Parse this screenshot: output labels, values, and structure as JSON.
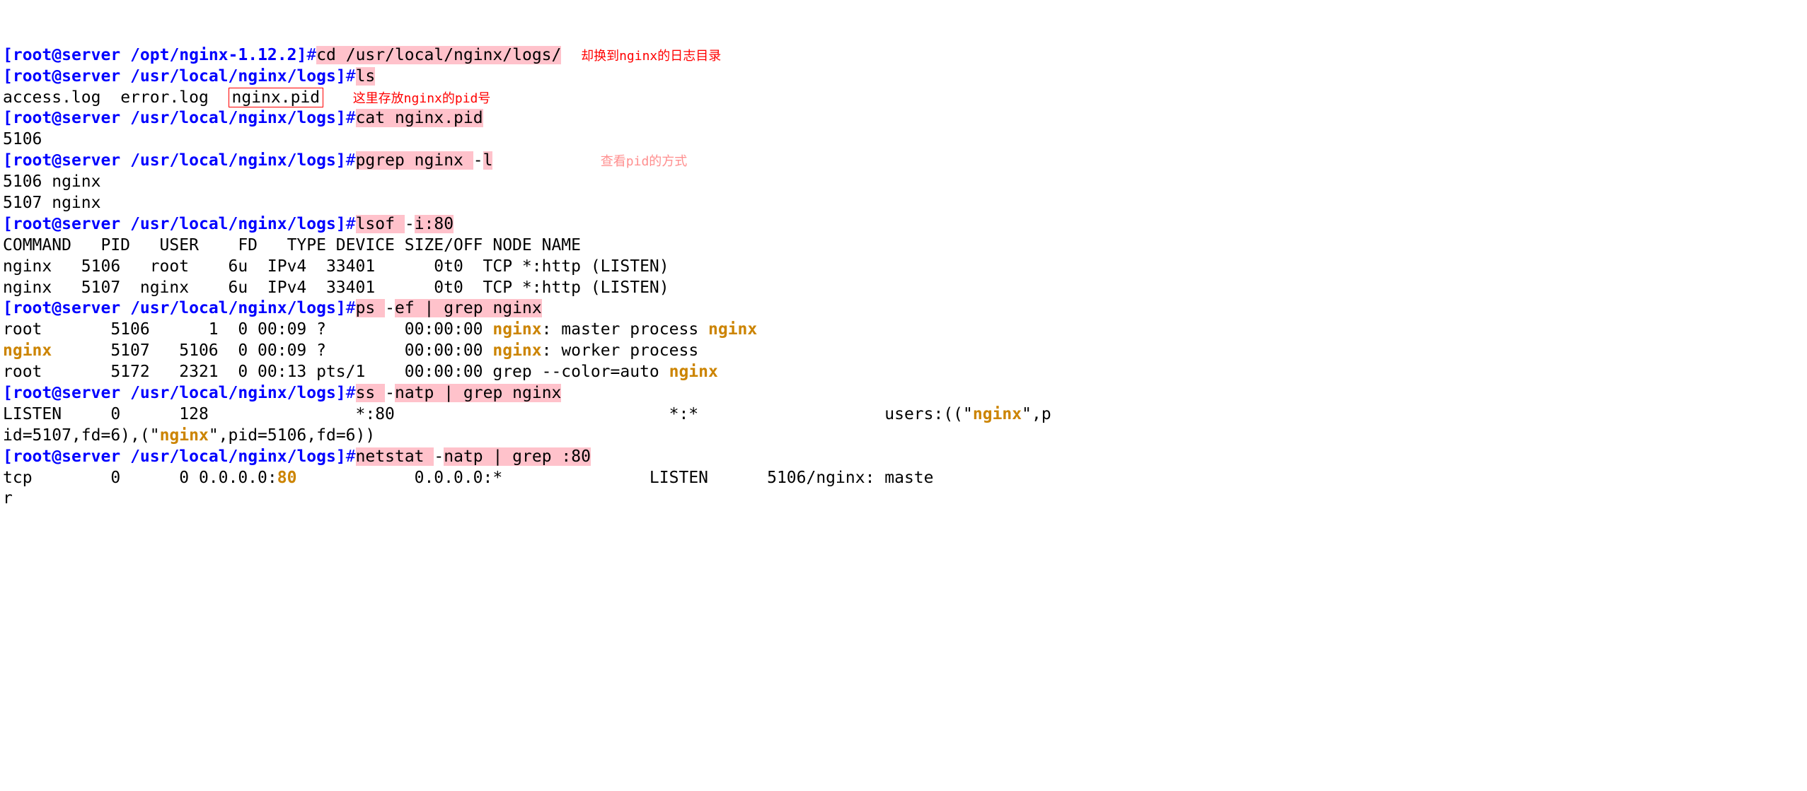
{
  "prompt": {
    "user": "root",
    "host": "server",
    "path1": "/opt/nginx-1.12.2",
    "path2": "/usr/local/nginx/logs"
  },
  "commands": {
    "cd": "cd /usr/local/nginx/logs/",
    "ls": "ls",
    "cat": "cat nginx.pid",
    "pgrep_pre": "pgrep nginx ",
    "pgrep_flag": "-",
    "pgrep_flag2": "l",
    "lsof_pre": "lsof ",
    "lsof_flag": "-",
    "lsof_rest": "i:80",
    "ps_pre": "ps ",
    "ps_dash": "-",
    "ps_rest": "ef | grep nginx",
    "ss_pre": "ss ",
    "ss_dash": "-",
    "ss_rest": "natp | grep nginx",
    "netstat_pre": "netstat ",
    "netstat_dash": "-",
    "netstat_rest": "natp | grep :80"
  },
  "annotations": {
    "cd": "却换到nginx的日志目录",
    "pid": "这里存放nginx的pid号",
    "pgrep": "查看pid的方式"
  },
  "ls_output": {
    "access": "access.log",
    "error": "error.log",
    "pid": "nginx.pid"
  },
  "cat_output": "5106",
  "pgrep_output": {
    "l1": "5106 nginx",
    "l2": "5107 nginx"
  },
  "lsof_header": "COMMAND   PID   USER    FD   TYPE DEVICE SIZE/OFF NODE NAME",
  "lsof_rows": {
    "r1": "nginx   5106   root    6u  IPv4  33401      0t0  TCP *:http (LISTEN)",
    "r2": "nginx   5107  nginx    6u  IPv4  33401      0t0  TCP *:http (LISTEN)"
  },
  "ps": {
    "r1_a": "root       5106      1  0 00:09 ?        00:00:00 ",
    "r1_nginx1": "nginx",
    "r1_b": ": master process ",
    "r1_nginx2": "nginx",
    "r2_user": "nginx",
    "r2_a": "      5107   5106  0 00:09 ?        00:00:00 ",
    "r2_nginx": "nginx",
    "r2_b": ": worker process",
    "r3_a": "root       5172   2321  0 00:13 pts/1    00:00:00 grep --color=auto ",
    "r3_nginx": "nginx"
  },
  "ss": {
    "l1_a": "LISTEN     0      128               *:80                            *:*                   users:((\"",
    "l1_nginx": "nginx",
    "l1_b": "\",p",
    "l2_a": "id=5107,fd=6),(\"",
    "l2_nginx": "nginx",
    "l2_b": "\",pid=5106,fd=6))"
  },
  "netstat": {
    "l1_a": "tcp        0      0 0.0.0.0:",
    "l1_port": "80",
    "l1_b": "            0.0.0.0:*               LISTEN      5106/nginx: maste",
    "l2": "r"
  }
}
